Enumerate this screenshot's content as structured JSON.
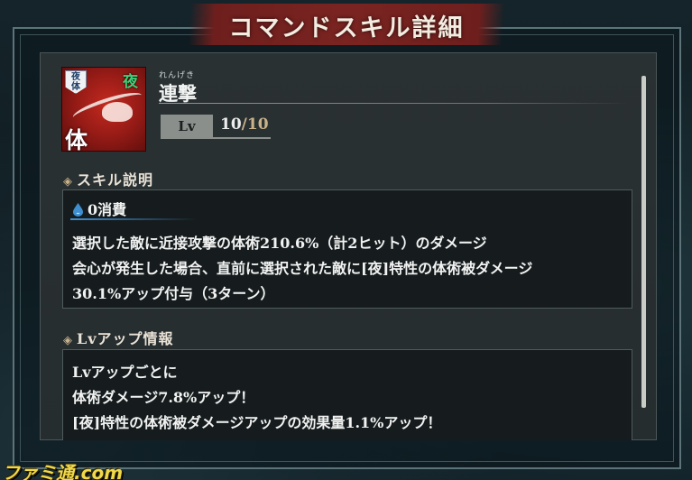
{
  "header": {
    "title": "コマンドスキル詳細"
  },
  "skill": {
    "icon_name": "slash-attack-icon",
    "badge_top": "夜\n体",
    "badge_night": "夜",
    "badge_body": "体",
    "ruby": "れんげき",
    "name": "連撃",
    "level_label": "Lv",
    "level_current": "10",
    "level_sep": "/",
    "level_max": "10"
  },
  "description": {
    "heading_mark": "◈",
    "heading": "スキル説明",
    "cost_icon": "water-drop-icon",
    "cost": "0消費",
    "lines": [
      "選択した敵に近接攻撃の体術210.6%（計2ヒット）のダメージ",
      "会心が発生した場合、直前に選択された敵に[夜]特性の体術被ダメージ",
      "30.1%アップ付与（3ターン）"
    ]
  },
  "levelup": {
    "heading_mark": "◈",
    "heading": "Lvアップ情報",
    "lines": [
      "Lvアップごとに",
      "体術ダメージ7.8%アップ！",
      "[夜]特性の体術被ダメージアップの効果量1.1%アップ！"
    ]
  },
  "watermark": "ファミ通.com",
  "colors": {
    "accent_red": "#7a2421",
    "accent_gold": "#c9b28a",
    "night_green": "#3fd07a",
    "cost_blue": "#3f8fd0"
  }
}
